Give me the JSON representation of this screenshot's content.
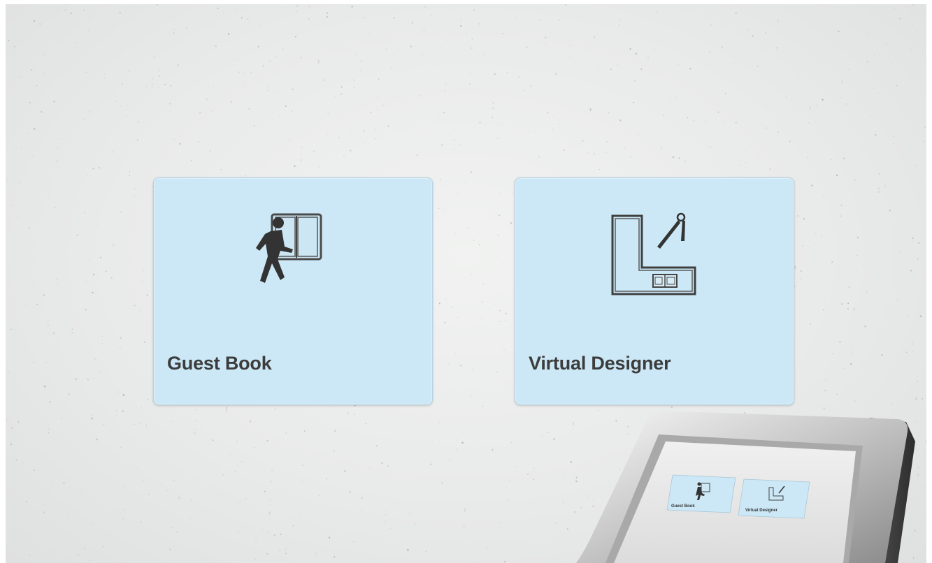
{
  "tiles": [
    {
      "label": "Guest Book",
      "icon": "guest-book-icon"
    },
    {
      "label": "Virtual Designer",
      "icon": "virtual-designer-icon"
    }
  ],
  "kiosk_preview": {
    "tiles": [
      {
        "label": "Guest Book"
      },
      {
        "label": "Virtual Designer"
      }
    ]
  },
  "colors": {
    "tile_fill": "#cce8f6",
    "tile_border": "#b7d3e1",
    "label_text": "#3c3c3c",
    "background": "#ebecec"
  }
}
